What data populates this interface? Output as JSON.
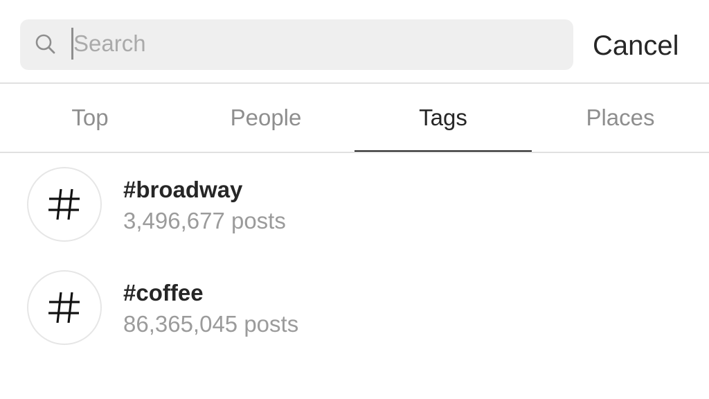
{
  "search": {
    "placeholder": "Search",
    "value": "",
    "cancel_label": "Cancel"
  },
  "tabs": [
    {
      "label": "Top",
      "active": false
    },
    {
      "label": "People",
      "active": false
    },
    {
      "label": "Tags",
      "active": true
    },
    {
      "label": "Places",
      "active": false
    }
  ],
  "results": [
    {
      "icon": "hashtag-icon",
      "name": "#broadway",
      "count": "3,496,677 posts"
    },
    {
      "icon": "hashtag-icon",
      "name": "#coffee",
      "count": "86,365,045 posts"
    }
  ],
  "colors": {
    "text_primary": "#262626",
    "text_secondary": "#8e8e8e",
    "search_bg": "#efefef",
    "divider": "#e0e0e0"
  }
}
